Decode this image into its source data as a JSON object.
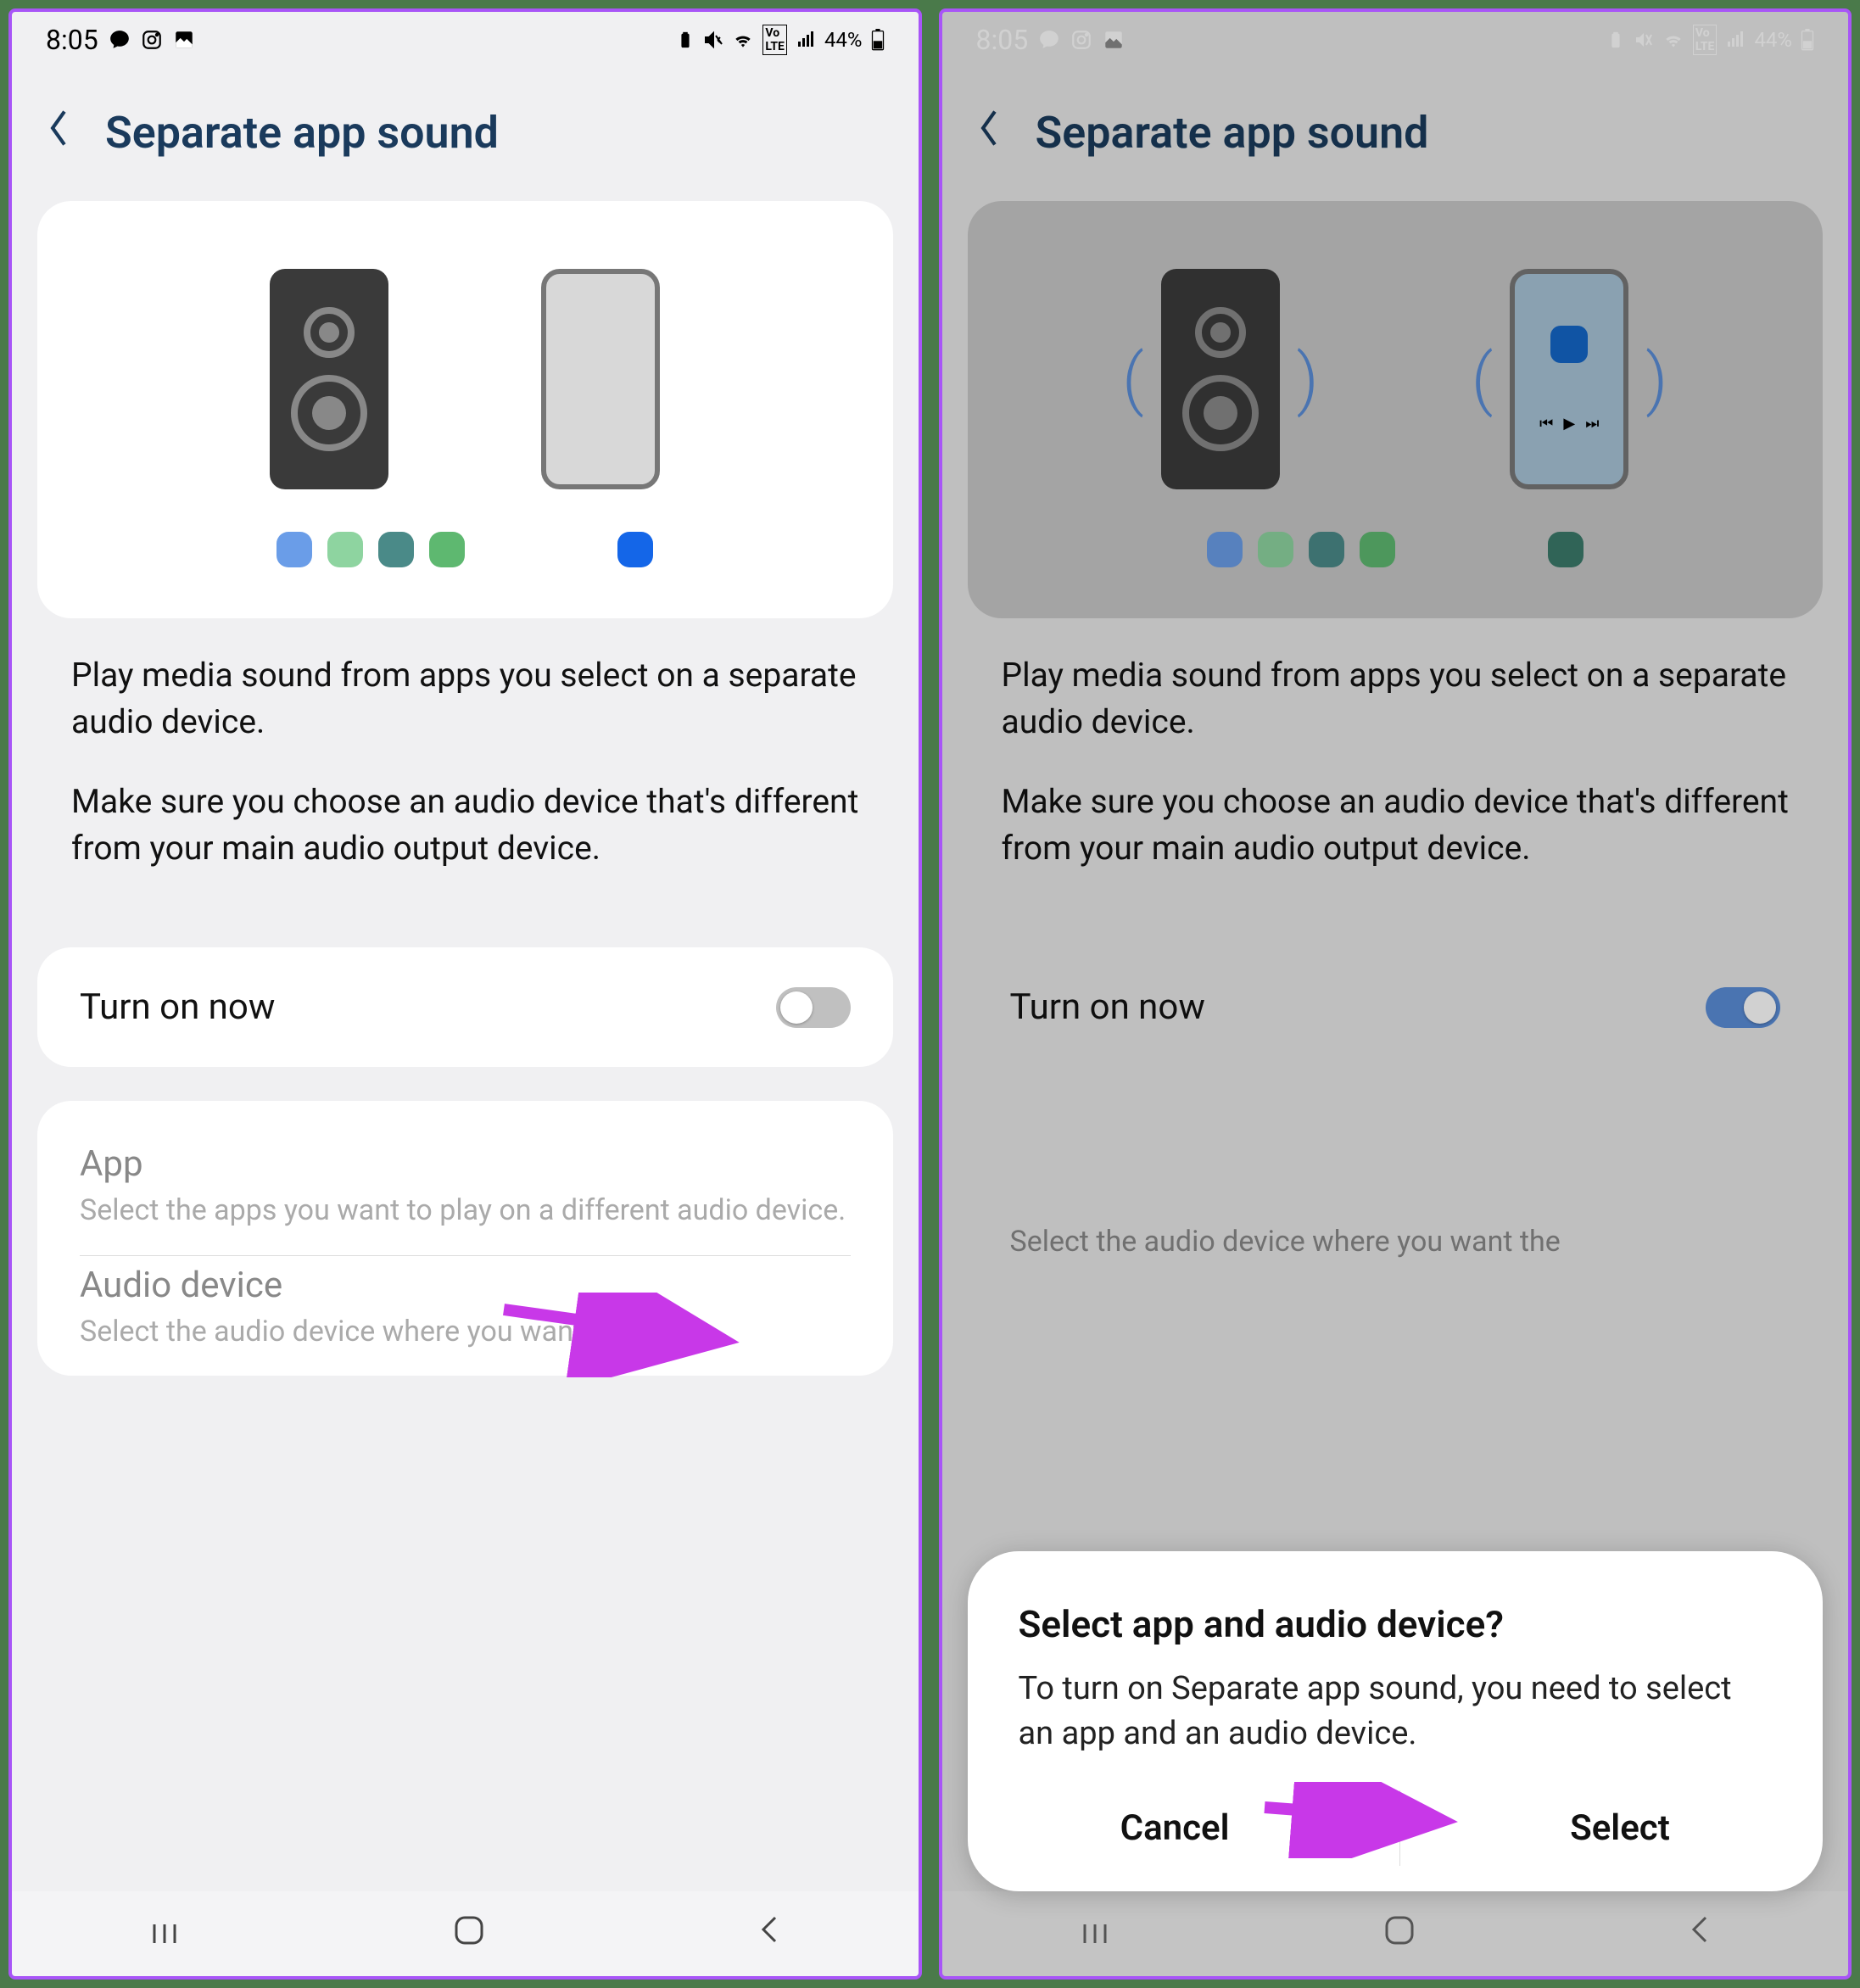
{
  "status": {
    "time": "8:05",
    "battery_pct": "44%"
  },
  "header": {
    "title": "Separate app sound"
  },
  "description": {
    "para1": "Play media sound from apps you select on a separate audio device.",
    "para2": "Make sure you choose an audio device that's different from your main audio output device."
  },
  "toggle": {
    "label": "Turn on now"
  },
  "options": {
    "app_title": "App",
    "app_desc": "Select the apps you want to play on a different audio device.",
    "device_title": "Audio device",
    "device_desc": "Select the audio device where you want the"
  },
  "dialog": {
    "title": "Select app and audio device?",
    "text": "To turn on Separate app sound, you need to select an app and an audio device.",
    "cancel": "Cancel",
    "select": "Select"
  },
  "nav": {
    "recents": "|||",
    "home": "◯",
    "back": "⟨"
  }
}
